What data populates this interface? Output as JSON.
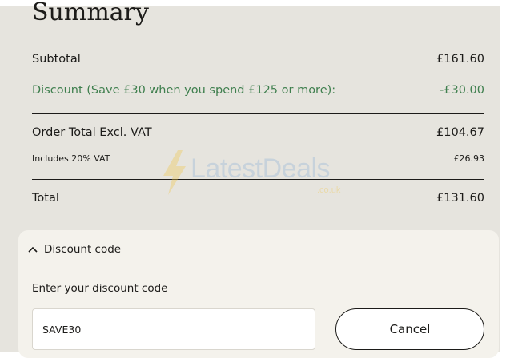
{
  "summary": {
    "title": "Summary",
    "subtotal": {
      "label": "Subtotal",
      "value": "£161.60"
    },
    "discount": {
      "label": "Discount (Save £30 when you spend £125 or more):",
      "value": "-£30.00",
      "color": "#3f7f4e"
    },
    "order_total_excl_vat": {
      "label": "Order Total Excl. VAT",
      "value": "£104.67"
    },
    "vat": {
      "label": "Includes 20% VAT",
      "value": "£26.93"
    },
    "total": {
      "label": "Total",
      "value": "£131.60"
    }
  },
  "discount_code": {
    "header_label": "Discount code",
    "header_icon": "chevron-up-icon",
    "input_label": "Enter your discount code",
    "input_value": "SAVE30",
    "cancel_label": "Cancel"
  },
  "watermark": {
    "brand": "LatestDeals",
    "domain": ".co.uk",
    "icon": "lightning-bolt-icon",
    "colors": {
      "text": "#8fb1d6",
      "bolt": "#f0c64a"
    }
  },
  "colors": {
    "panel_background": "#e6e4de",
    "card_background": "#f4f2ec",
    "text": "#1c1b19",
    "discount_green": "#3f7f4e"
  }
}
